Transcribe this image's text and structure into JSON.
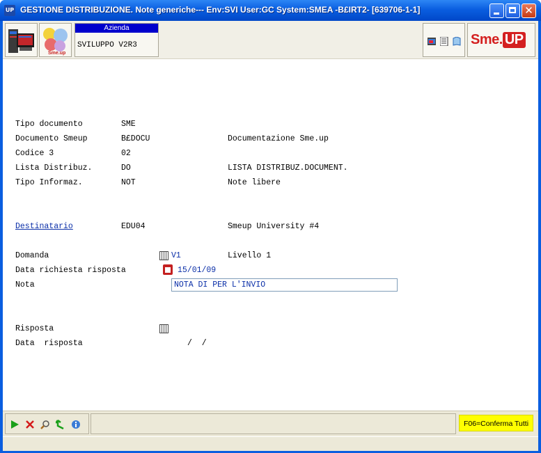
{
  "window": {
    "app_badge": "UP",
    "title": "GESTIONE DISTRIBUZIONE.  Note generiche---  Env:SVI User:GC System:SMEA -B£IRT2- [639706-1-1]",
    "close_glyph": "✕"
  },
  "toolbar": {
    "azienda_label": "Azienda",
    "azienda_value": "SVILUPPO V2R3",
    "logo_text_left": "Sme.",
    "logo_text_right": "UP",
    "icons": [
      "monitor-icon",
      "smeup-balls-icon",
      "window-icon",
      "document-icon",
      "book-icon"
    ]
  },
  "form": {
    "fields": [
      {
        "label": "Tipo documento",
        "value": "SME",
        "desc": ""
      },
      {
        "label": "Documento Smeup",
        "value": "B£DOCU",
        "desc": "Documentazione Sme.up"
      },
      {
        "label": "Codice 3",
        "value": "02",
        "desc": ""
      },
      {
        "label": "Lista Distribuz.",
        "value": "DO",
        "desc": "LISTA DISTRIBUZ.DOCUMENT."
      },
      {
        "label": "Tipo Informaz.",
        "value": "NOT",
        "desc": "Note libere"
      }
    ],
    "destinatario": {
      "label": "Destinatario",
      "value": "EDU04",
      "desc": "Smeup University #4"
    },
    "domanda": {
      "label": "Domanda",
      "value": "V1",
      "desc": "Livello 1"
    },
    "data_richiesta": {
      "label": "Data richiesta risposta",
      "value": "15/01/09"
    },
    "nota": {
      "label": "Nota",
      "value": "NOTA DI PER L'INVIO"
    },
    "risposta": {
      "label": "Risposta"
    },
    "data_risposta": {
      "label": "Data  risposta",
      "value": "/  /"
    }
  },
  "bottombar": {
    "icons": [
      "play-icon",
      "cancel-icon",
      "search-icon",
      "back-arrow-icon",
      "info-icon"
    ],
    "f06_label": "F06=Conferma Tutti"
  },
  "colors": {
    "titlebar": "#0a5ee0",
    "link": "#0b2fa8",
    "f06_bg": "#ffff00",
    "azienda_header": "#0000cc"
  }
}
